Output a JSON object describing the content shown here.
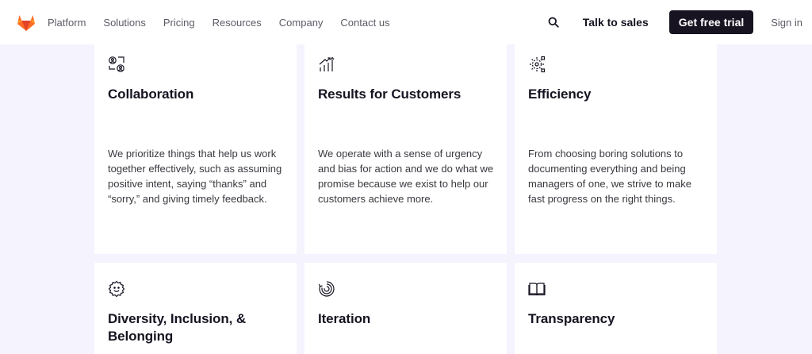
{
  "nav": {
    "links": [
      "Platform",
      "Solutions",
      "Pricing",
      "Resources",
      "Company",
      "Contact us"
    ],
    "talk_to_sales": "Talk to sales",
    "free_trial": "Get free trial",
    "sign_in": "Sign in",
    "brand_color": "#fc6d26"
  },
  "cards": [
    {
      "icon": "collaboration-icon",
      "title": "Collaboration",
      "text": "We prioritize things that help us work together effectively, such as assuming positive intent, saying “thanks” and “sorry,” and giving timely feedback."
    },
    {
      "icon": "chart-growth-icon",
      "title": "Results for Customers",
      "text": "We operate with a sense of urgency and bias for action and we do what we promise because we exist to help our customers achieve more."
    },
    {
      "icon": "efficiency-icon",
      "title": "Efficiency",
      "text": "From choosing boring solutions to documenting everything and being managers of one, we strive to make fast progress on the right things."
    },
    {
      "icon": "diversity-icon",
      "title": "Diversity, Inclusion, & Belonging",
      "text": ""
    },
    {
      "icon": "iteration-icon",
      "title": "Iteration",
      "text": ""
    },
    {
      "icon": "book-icon",
      "title": "Transparency",
      "text": ""
    }
  ]
}
